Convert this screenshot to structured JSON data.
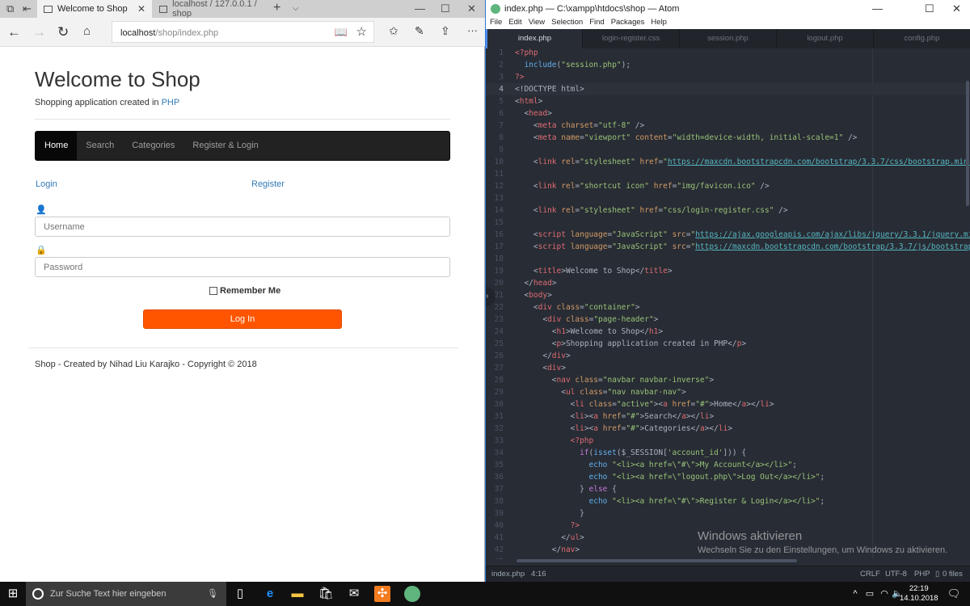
{
  "browser": {
    "tabs": [
      {
        "label": "Welcome to Shop",
        "active": true
      },
      {
        "label": "localhost / 127.0.0.1 / shop",
        "active": false
      }
    ],
    "address": {
      "host": "localhost",
      "path": "/shop/index.php"
    },
    "page": {
      "title": "Welcome to Shop",
      "subtitle_prefix": "Shopping application created in ",
      "subtitle_link": "PHP",
      "nav": [
        "Home",
        "Search",
        "Categories",
        "Register & Login"
      ],
      "login_link": "Login",
      "register_link": "Register",
      "username_placeholder": "Username",
      "password_placeholder": "Password",
      "remember_label": "Remember Me",
      "login_button": "Log In",
      "footer": "Shop - Created by Nihad Liu Karajko - Copyright © 2018",
      "accent": "#ff5500"
    }
  },
  "editor": {
    "title": "index.php — C:\\xampp\\htdocs\\shop — Atom",
    "menu": [
      "File",
      "Edit",
      "View",
      "Selection",
      "Find",
      "Packages",
      "Help"
    ],
    "tabs": [
      "index.php",
      "login-register.css",
      "session.php",
      "logout.php",
      "config.php"
    ],
    "active_tab": "index.php",
    "current_line": 4,
    "lines": [
      "<?php",
      "  include(\"session.php\");",
      "?>",
      "<!DOCTYPE html>",
      "<html>",
      "  <head>",
      "    <meta charset=\"utf-8\" />",
      "    <meta name=\"viewport\" content=\"width=device-width, initial-scale=1\" />",
      "",
      "    <link rel=\"stylesheet\" href=\"https://maxcdn.bootstrapcdn.com/bootstrap/3.3.7/css/bootstrap.min.cs",
      "",
      "    <link rel=\"shortcut icon\" href=\"img/favicon.ico\" />",
      "",
      "    <link rel=\"stylesheet\" href=\"css/login-register.css\" />",
      "",
      "    <script language=\"JavaScript\" src=\"https://ajax.googleapis.com/ajax/libs/jquery/3.3.1/jquery.min.",
      "    <script language=\"JavaScript\" src=\"https://maxcdn.bootstrapcdn.com/bootstrap/3.3.7/js/bootstrap.m",
      "",
      "    <title>Welcome to Shop</title>",
      "  </head>",
      "  <body>",
      "    <div class=\"container\">",
      "      <div class=\"page-header\">",
      "        <h1>Welcome to Shop</h1>",
      "        <p>Shopping application created in PHP</p>",
      "      </div>",
      "      <div>",
      "        <nav class=\"navbar navbar-inverse\">",
      "          <ul class=\"nav navbar-nav\">",
      "            <li class=\"active\"><a href=\"#\">Home</a></li>",
      "            <li><a href=\"#\">Search</a></li>",
      "            <li><a href=\"#\">Categories</a></li>",
      "            <?php",
      "              if(isset($_SESSION['account_id'])) {",
      "                echo \"<li><a href=\\\"#\\\">My Account</a></li>\";",
      "                echo \"<li><a href=\\\"logout.php\\\">Log Out</a></li>\";",
      "              } else {",
      "                echo \"<li><a href=\\\"#\\\">Register & Login</a></li>\";",
      "              }",
      "            ?>",
      "          </ul>",
      "        </nav>",
      ""
    ],
    "status": {
      "file": "index.php",
      "cursor": "4:16",
      "line_ending": "CRLF",
      "encoding": "UTF-8",
      "grammar": "PHP",
      "git": "0 files"
    },
    "watermark": {
      "title": "Windows aktivieren",
      "text": "Wechseln Sie zu den Einstellungen, um Windows zu aktivieren."
    }
  },
  "taskbar": {
    "search_placeholder": "Zur Suche Text hier eingeben",
    "time": "22:19",
    "date": "14.10.2018"
  }
}
